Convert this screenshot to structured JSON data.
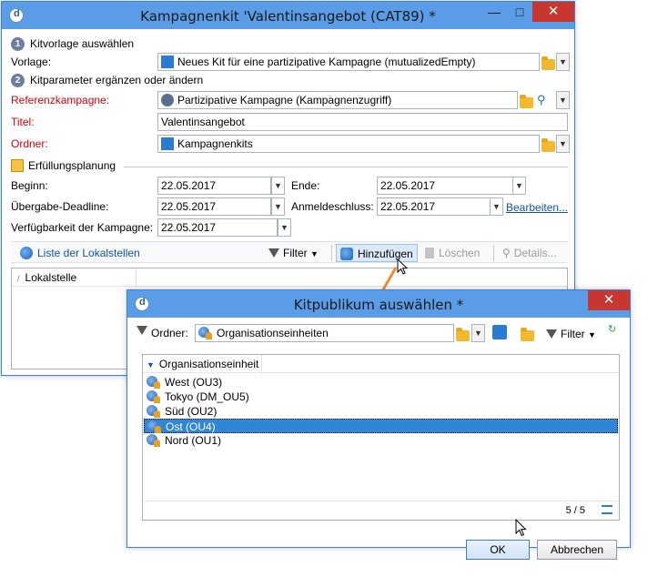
{
  "main": {
    "title": "Kampagnenkit 'Valentinsangebot (CAT89) *",
    "step1": {
      "num": "1",
      "label": "Kitvorlage auswählen"
    },
    "vorlage": {
      "label": "Vorlage:",
      "value": "Neues Kit für eine partizipative Kampagne (mutualizedEmpty)"
    },
    "step2": {
      "num": "2",
      "label": "Kitparameter ergänzen oder ändern"
    },
    "referenz": {
      "label": "Referenzkampagne:",
      "value": "Partizipative Kampagne (Kampagnenzugriff)"
    },
    "titel": {
      "label": "Titel:",
      "value": "Valentinsangebot"
    },
    "ordner": {
      "label": "Ordner:",
      "value": "Kampagnenkits"
    },
    "planning": {
      "label": "Erfüllungsplanung"
    },
    "beginn": {
      "label": "Beginn:",
      "value": "22.05.2017"
    },
    "ende": {
      "label": "Ende:",
      "value": "22.05.2017"
    },
    "deadline": {
      "label": "Übergabe-Deadline:",
      "value": "22.05.2017"
    },
    "anmeldeschluss": {
      "label": "Anmeldeschluss:",
      "value": "22.05.2017"
    },
    "bearbeiten": "Bearbeiten...",
    "verfuegbarkeit": {
      "label": "Verfügbarkeit der Kampagne:",
      "value": "22.05.2017"
    },
    "toolbar": {
      "list": "Liste der Lokalstellen",
      "filter": "Filter",
      "add": "Hinzufügen",
      "delete": "Löschen",
      "details": "Details..."
    },
    "grid_header": "Lokalstelle"
  },
  "popup": {
    "title": "Kitpublikum auswählen *",
    "ordner_label": "Ordner:",
    "ordner_value": "Organisationseinheiten",
    "filter": "Filter",
    "column": "Organisationseinheit",
    "items": [
      {
        "label": "West (OU3)"
      },
      {
        "label": "Tokyo (DM_OU5)"
      },
      {
        "label": "Süd (OU2)"
      },
      {
        "label": "Ost (OU4)"
      },
      {
        "label": "Nord (OU1)"
      }
    ],
    "count": "5 / 5",
    "ok": "OK",
    "cancel": "Abbrechen"
  },
  "colors": {
    "titlebar": "#5b9ce6",
    "close": "#c7372f",
    "required": "#d4000f",
    "link": "#1552a9",
    "selection": "#2f86d5",
    "arrow": "#ef8c38"
  }
}
